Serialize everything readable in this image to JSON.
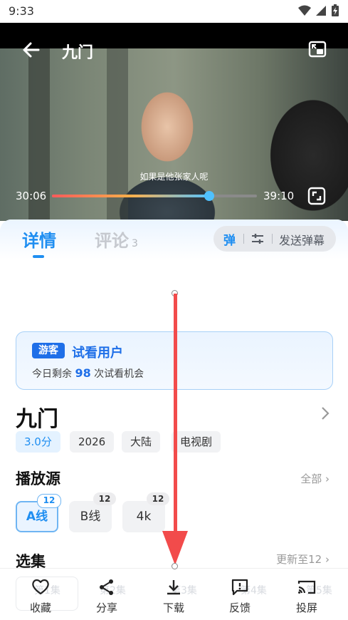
{
  "status_bar": {
    "time": "9:33"
  },
  "player": {
    "title": "九门",
    "subtitle_text": "如果是他张家人呢",
    "current_time": "30:06",
    "duration": "39:10",
    "progress": 0.768
  },
  "tabs": {
    "detail": "详情",
    "comments": "评论",
    "comment_count": "3"
  },
  "danmu": {
    "toggle": "弹",
    "send": "发送弹幕"
  },
  "guest": {
    "badge": "游客",
    "title": "试看用户",
    "prefix": "今日剩余",
    "count": "98",
    "suffix": "次试看机会"
  },
  "show": {
    "title": "九门",
    "tags": [
      "3.0分",
      "2026",
      "大陆",
      "电视剧"
    ]
  },
  "sources": {
    "title": "播放源",
    "all_link": "全部",
    "items": [
      {
        "label": "A线",
        "count": "12",
        "active": true
      },
      {
        "label": "B线",
        "count": "12",
        "active": false
      },
      {
        "label": "4k",
        "count": "12",
        "active": false
      }
    ]
  },
  "episodes": {
    "title": "选集",
    "update_link": "更新至12",
    "faded": [
      "第1集",
      "第2集",
      "第3集",
      "第4集",
      "第5集"
    ]
  },
  "bottom_nav": {
    "favorite": "收藏",
    "share": "分享",
    "download": "下载",
    "feedback": "反馈",
    "cast": "投屏"
  },
  "colors": {
    "accent": "#1f8ef1",
    "guest_blue": "#1f6fe8",
    "annotation_arrow": "#f24b4b"
  }
}
